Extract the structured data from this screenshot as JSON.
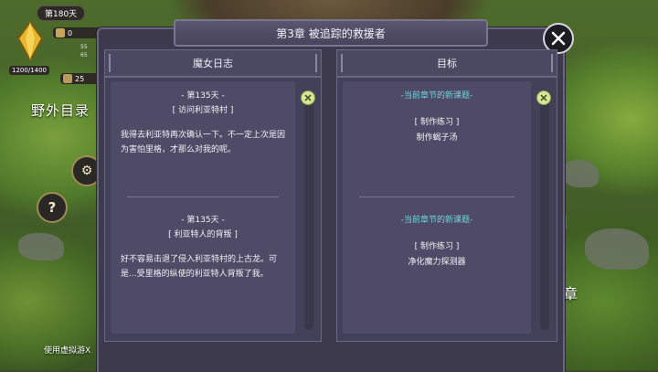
{
  "hud": {
    "day": "第180天",
    "hp": "1200/1400",
    "res1": "0",
    "stat1": "55",
    "stat2": "65",
    "res2": "25",
    "map_label": "野外目录",
    "help": "?",
    "virtual_text": "使用虚拟游X",
    "right_bg_text": "章"
  },
  "dialog": {
    "title": "第3章  被追踪的救援者",
    "left_panel": {
      "title": "魔女日志",
      "entries": [
        {
          "day": "- 第135天 -",
          "subtitle": "[ 访问利亚特村 ]",
          "body": "我得去利亚特再次确认一下。不一定上次是因为害怕里格，才那么对我的呢。"
        },
        {
          "day": "- 第135天 -",
          "subtitle": "[ 利亚特人的背叛 ]",
          "body": "好不容易击退了侵入利亚特村的上古龙。可是...受里格的纵使的利亚特人背叛了我。"
        }
      ]
    },
    "right_panel": {
      "title": "目标",
      "goals": [
        {
          "header": "-当前章节的新课题-",
          "type": "[ 制作练习 ]",
          "task": "制作蝎子汤"
        },
        {
          "header": "-当前章节的新课题-",
          "type": "[ 制作练习 ]",
          "task": "净化魔力探测器"
        }
      ]
    }
  }
}
